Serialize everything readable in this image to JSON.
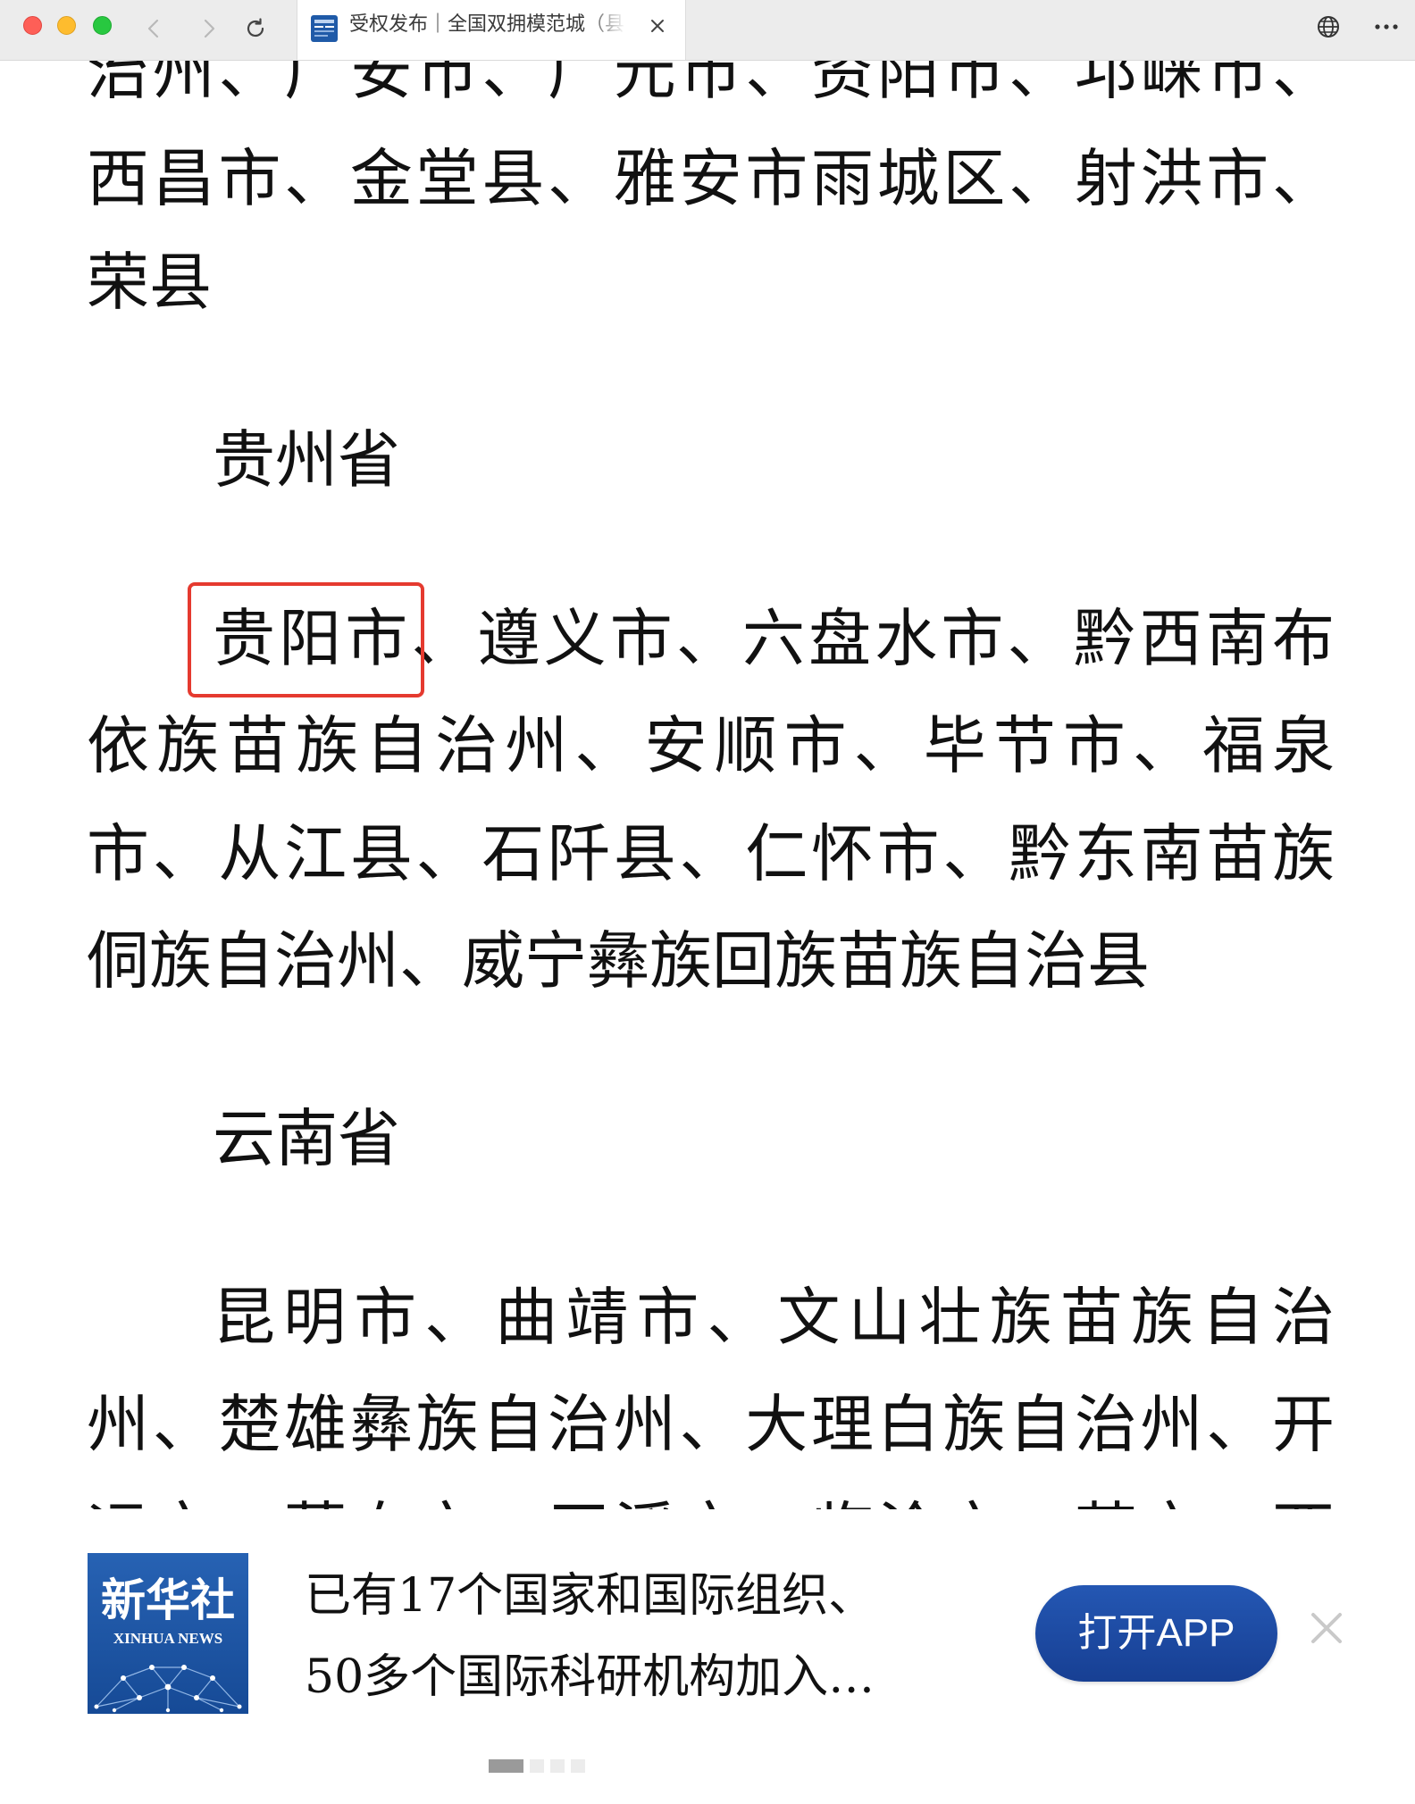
{
  "browser": {
    "tab_title": "受权发布｜全国双拥模范城（县",
    "icons": [
      "close-window",
      "minimize-window",
      "zoom-window",
      "back-arrow",
      "forward-arrow",
      "reload",
      "favicon",
      "tab-close",
      "globe",
      "more-menu"
    ]
  },
  "article": {
    "sichuan_lines": [
      "治州、广安市、广元市、资阳市、邛崃市、",
      "西昌市、金堂县、雅安市雨城区、射洪市、",
      "荣县"
    ],
    "guizhou": {
      "heading": "贵州省",
      "highlighted": "贵阳市",
      "first_line_rest": "、遵义市、六盘水市、黔西南布",
      "lines": [
        "依族苗族自治州、安顺市、毕节市、福泉",
        "市、从江县、石阡县、仁怀市、黔东南苗族",
        "侗族自治州、威宁彝族回族苗族自治县"
      ]
    },
    "yunnan": {
      "heading": "云南省",
      "lines": [
        "昆明市、曲靖市、文山壮族苗族自治",
        "州、楚雄彝族自治州、大理白族自治州、开",
        "远市、蒙自市、玉溪市、临沧市、芒市、西"
      ]
    }
  },
  "banner": {
    "logo_cn": "新华社",
    "logo_en": "XINHUA NEWS",
    "headline_lines": [
      "已有17个国家和国际组织、",
      "50多个国际科研机构加入…"
    ],
    "button_label": "打开APP"
  },
  "pagination": {
    "total": 4,
    "active": 1
  },
  "colors": {
    "highlight": "#e53a2f",
    "button": "#1c4aa0",
    "logo_bg": "#1b56a6",
    "text": "#111111"
  }
}
